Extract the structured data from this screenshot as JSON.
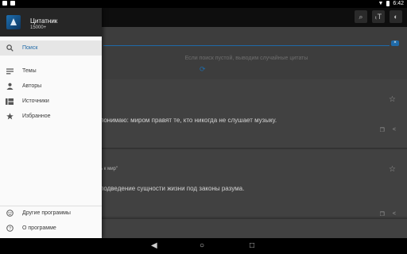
{
  "status_bar": {
    "time": "6:42"
  },
  "app": {
    "title": "Цитатник",
    "quote_count": "15000+"
  },
  "menu": {
    "items": [
      {
        "label": "Поиск",
        "icon": "search-icon",
        "active": true
      },
      {
        "label": "Темы",
        "icon": "topics-icon",
        "active": false
      },
      {
        "label": "Авторы",
        "icon": "person-icon",
        "active": false
      },
      {
        "label": "Источники",
        "icon": "sources-icon",
        "active": false
      },
      {
        "label": "Избранное",
        "icon": "star-icon",
        "active": false
      }
    ],
    "footer_items": [
      {
        "label": "Другие программы",
        "icon": "smiley-icon"
      },
      {
        "label": "О программе",
        "icon": "help-icon"
      }
    ]
  },
  "background": {
    "search_hint": "Если поиск пустой, выводим случайные цитаты",
    "quotes": [
      {
        "text": "понимаю: миром правят те, кто никогда не слушает музыку."
      },
      {
        "title": "ь к мир\"",
        "text": "подведение сущности жизни под законы разума."
      }
    ]
  },
  "colors": {
    "accent": "#1f6aa8",
    "drawer_header": "#262626"
  }
}
